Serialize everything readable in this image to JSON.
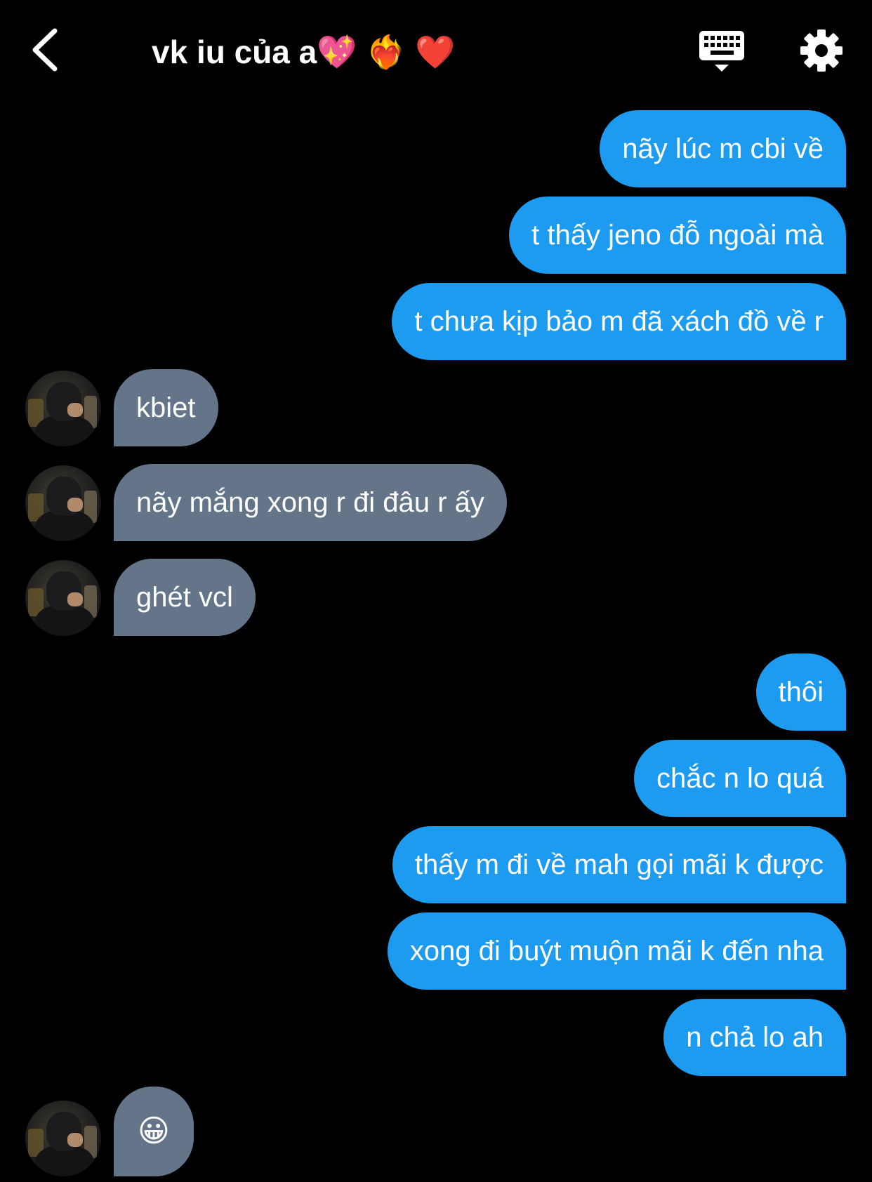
{
  "header": {
    "title": "vk iu của a💖 ❤️‍🔥 ❤️",
    "back_icon": "chevron-left-icon",
    "keyboard_icon": "keyboard-icon",
    "settings_icon": "gear-icon"
  },
  "colors": {
    "background": "#000000",
    "outgoing_bubble": "#1d9bf0",
    "incoming_bubble": "#64758a",
    "text": "#ffffff"
  },
  "messages": [
    {
      "direction": "out",
      "text": "nãy lúc m cbi về"
    },
    {
      "direction": "out",
      "text": "t thấy jeno đỗ ngoài mà"
    },
    {
      "direction": "out",
      "text": "t chưa kịp bảo m đã xách đồ về r"
    },
    {
      "direction": "in",
      "text": "kbiet"
    },
    {
      "direction": "in",
      "text": "nãy mắng xong r đi đâu r ấy"
    },
    {
      "direction": "in",
      "text": "ghét vcl"
    },
    {
      "direction": "out",
      "text": "thôi"
    },
    {
      "direction": "out",
      "text": "chắc n lo quá"
    },
    {
      "direction": "out",
      "text": "thấy m đi về mah gọi mãi k được"
    },
    {
      "direction": "out",
      "text": "xong đi buýt muộn mãi k đến nha"
    },
    {
      "direction": "out",
      "text": "n chả lo ah"
    },
    {
      "direction": "in",
      "text": "😀"
    }
  ]
}
